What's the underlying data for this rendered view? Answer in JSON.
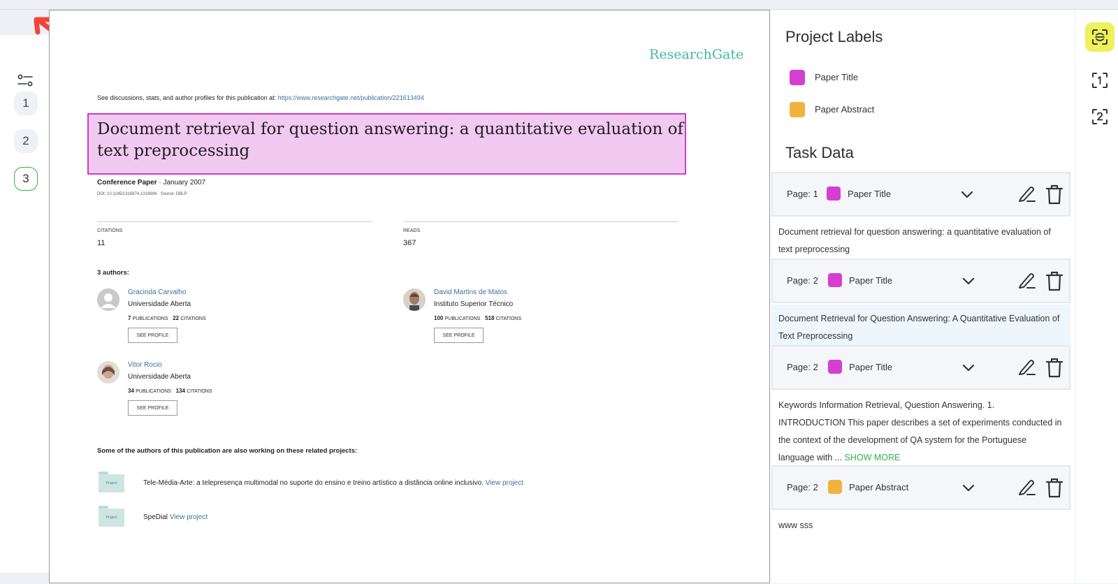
{
  "sidebar": {
    "filter_icon": "filter-sliders-icon",
    "pages": [
      "1",
      "2",
      "3"
    ],
    "active_page": "3"
  },
  "document": {
    "logo": "ResearchGate",
    "discussion_text": "See discussions, stats, and author profiles for this publication at: ",
    "discussion_link": "https://www.researchgate.net/publication/221613494",
    "title": "Document retrieval for question answering: a quantitative evaluation of text preprocessing",
    "conference_label": "Conference Paper",
    "conference_date": " · January 2007",
    "doi": "DOI: 10.1145/1316874.1316894 · Source: DBLP",
    "citations_label": "CITATIONS",
    "citations_value": "11",
    "reads_label": "READS",
    "reads_value": "367",
    "authors_heading": "3 authors:",
    "authors": [
      {
        "name": "Gracinda Carvalho",
        "inst": "Universidade Aberta",
        "pubs": "7",
        "pubs_label": "PUBLICATIONS",
        "cites": "22",
        "cites_label": "CITATIONS",
        "button": "SEE PROFILE"
      },
      {
        "name": "David Martins de Matos",
        "inst": "Instituto Superior Técnico",
        "pubs": "100",
        "pubs_label": "PUBLICATIONS",
        "cites": "518",
        "cites_label": "CITATIONS",
        "button": "SEE PROFILE"
      },
      {
        "name": "Vitor Rocio",
        "inst": "Universidade Aberta",
        "pubs": "34",
        "pubs_label": "PUBLICATIONS",
        "cites": "134",
        "cites_label": "CITATIONS",
        "button": "SEE PROFILE"
      }
    ],
    "related_heading": "Some of the authors of this publication are also working on these related projects:",
    "projects": [
      {
        "folder_label": "Project",
        "text": "Tele-Média-Arte: a telepresença multimodal no suporte do ensino e treino artístico a distância online inclusivo. ",
        "link": "View project"
      },
      {
        "folder_label": "Project",
        "text": "SpeDial ",
        "link": "View project"
      }
    ]
  },
  "project_labels": {
    "heading": "Project Labels",
    "items": [
      {
        "label": "Paper Title",
        "color": "#d63dd1"
      },
      {
        "label": "Paper Abstract",
        "color": "#f2b33d"
      }
    ]
  },
  "task_data": {
    "heading": "Task Data",
    "cards": [
      {
        "page": "Page: 1",
        "label": "Paper Title",
        "color": "#d63dd1",
        "text": "Document retrieval for question answering: a quantitative evaluation of text preprocessing",
        "more": ""
      },
      {
        "page": "Page: 2",
        "label": "Paper Title",
        "color": "#d63dd1",
        "text": "Document Retrieval for Question Answering: A Quantitative Evaluation of Text Preprocessing",
        "more": ""
      },
      {
        "page": "Page: 2",
        "label": "Paper Title",
        "color": "#d63dd1",
        "text": "Keywords Information Retrieval, Question Answering. 1. INTRODUCTION This paper describes a set of experiments conducted in the context of the development of QA system for the Portuguese language with ... ",
        "more": "SHOW MORE"
      },
      {
        "page": "Page: 2",
        "label": "Paper Abstract",
        "color": "#f2b33d",
        "text": "www sss",
        "more": ""
      }
    ]
  },
  "toolbar": {
    "tools": [
      "scan-icon",
      "page-1-select-icon",
      "page-2-select-icon"
    ]
  }
}
